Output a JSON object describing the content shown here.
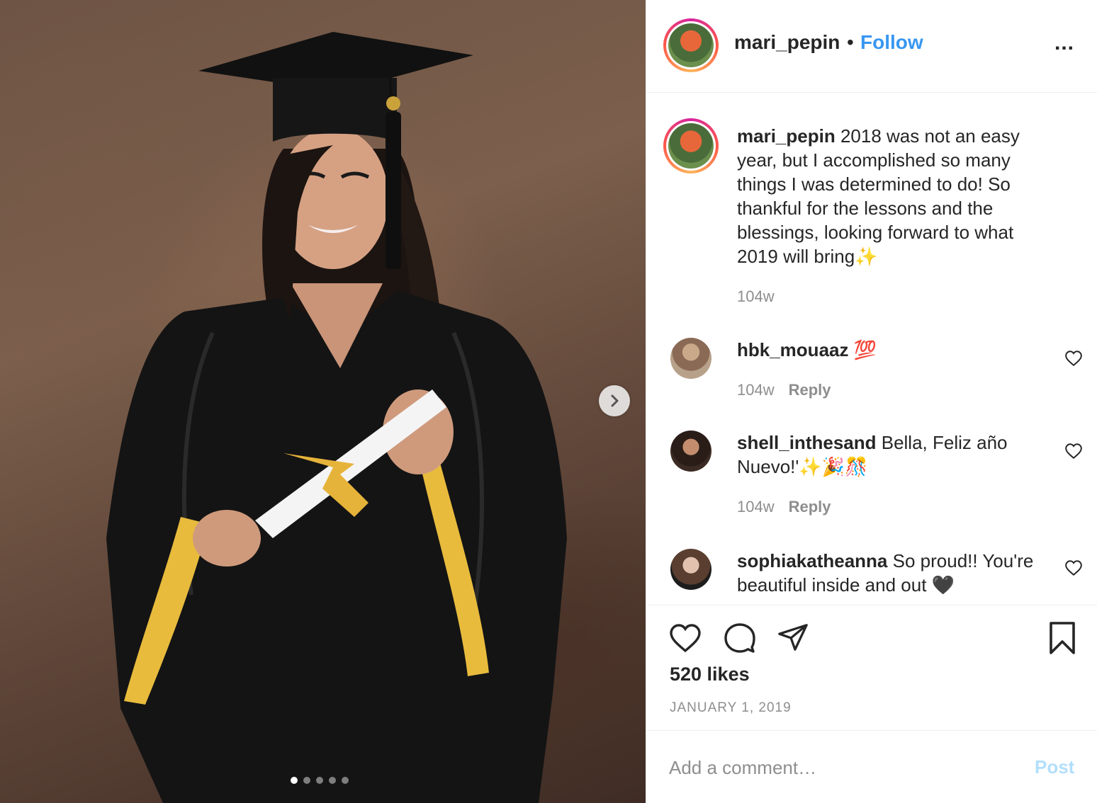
{
  "post": {
    "slide_count": 5,
    "active_slide": 1
  },
  "header": {
    "username": "mari_pepin",
    "separator": "•",
    "follow_label": "Follow",
    "more_label": "..."
  },
  "caption": {
    "username": "mari_pepin",
    "text": " 2018 was not an easy year, but I accomplished so many things I was determined to do! So thankful for the lessons and the blessings, looking forward to what 2019 will bring✨",
    "time": "104w"
  },
  "comments": [
    {
      "username": "hbk_mouaaz",
      "text": " 💯",
      "time": "104w",
      "reply_label": "Reply"
    },
    {
      "username": "shell_inthesand",
      "text": " Bella, Feliz año Nuevo!'✨🎉🎊",
      "time": "104w",
      "reply_label": "Reply"
    },
    {
      "username": "sophiakatheanna",
      "text": " So proud!! You're beautiful inside and out 🖤"
    }
  ],
  "footer": {
    "likes": "520 likes",
    "date": "JANUARY 1, 2019",
    "comment_placeholder": "Add a comment…",
    "post_label": "Post"
  },
  "icons": {
    "like": "heart-icon",
    "comment": "comment-icon",
    "share": "paper-plane-icon",
    "save": "bookmark-icon",
    "next": "chevron-right-icon"
  },
  "colors": {
    "link_blue": "#3897f0",
    "post_disabled": "#b2dffc",
    "muted": "#8e8e8e",
    "text": "#262626"
  }
}
